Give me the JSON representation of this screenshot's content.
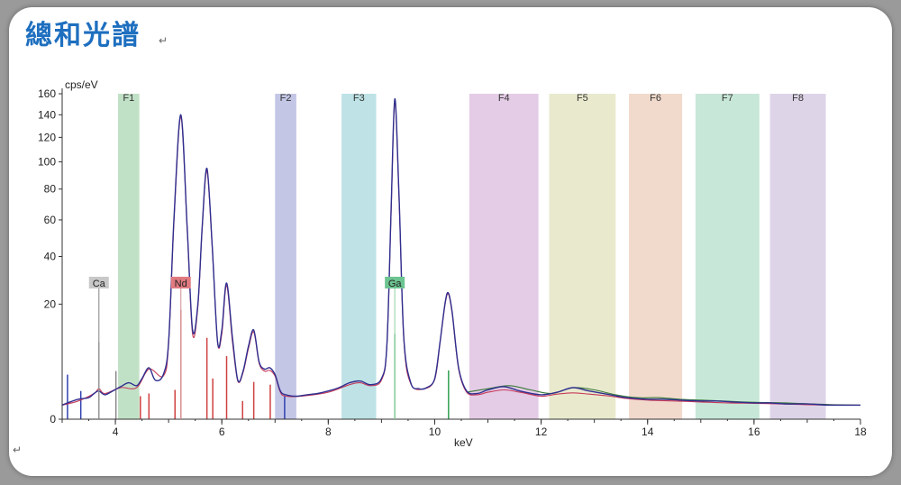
{
  "page": {
    "title": "總和光譜",
    "para_mark": "↵"
  },
  "chart_data": {
    "type": "line",
    "ylabel": "cps/eV",
    "xlabel": "keV",
    "xlim": [
      3.0,
      18.0
    ],
    "ylim": [
      0,
      160
    ],
    "y_scale": "sqrt",
    "x_ticks": [
      4,
      6,
      8,
      10,
      12,
      14,
      16,
      18
    ],
    "y_ticks": [
      0,
      20,
      40,
      60,
      80,
      100,
      120,
      140,
      160
    ],
    "grid": false,
    "bands": [
      {
        "name": "F1",
        "x0": 4.05,
        "x1": 4.45,
        "color": "#b6dcbc"
      },
      {
        "name": "F2",
        "x0": 7.0,
        "x1": 7.4,
        "color": "#b9bce0"
      },
      {
        "name": "F3",
        "x0": 8.25,
        "x1": 8.9,
        "color": "#b3dde0"
      },
      {
        "name": "F4",
        "x0": 10.65,
        "x1": 11.95,
        "color": "#dfc3e2"
      },
      {
        "name": "F5",
        "x0": 12.15,
        "x1": 13.4,
        "color": "#e5e6c4"
      },
      {
        "name": "F6",
        "x0": 13.65,
        "x1": 14.65,
        "color": "#efd3c3"
      },
      {
        "name": "F7",
        "x0": 14.9,
        "x1": 16.1,
        "color": "#bde3d1"
      },
      {
        "name": "F8",
        "x0": 16.3,
        "x1": 17.35,
        "color": "#d8cce4"
      }
    ],
    "elements": [
      {
        "symbol": "Ca",
        "x": 3.69,
        "label_y": 28,
        "box": "#c8c8c8",
        "line": "#999999"
      },
      {
        "symbol": "Nd",
        "x": 5.23,
        "label_y": 28,
        "box": "#e07a80",
        "line": "#d9a0a4"
      },
      {
        "symbol": "Ga",
        "x": 9.25,
        "label_y": 28,
        "box": "#6cc490",
        "line": "#9fd8b0"
      }
    ],
    "markers": [
      {
        "x": 3.1,
        "h": 3.0,
        "color": "#3040b0"
      },
      {
        "x": 3.35,
        "h": 1.2,
        "color": "#3040b0"
      },
      {
        "x": 3.69,
        "h": 9.0,
        "color": "#888888"
      },
      {
        "x": 4.01,
        "h": 3.5,
        "color": "#888888"
      },
      {
        "x": 4.63,
        "h": 1.0,
        "color": "#d04040"
      },
      {
        "x": 4.47,
        "h": 0.8,
        "color": "#d04040"
      },
      {
        "x": 5.12,
        "h": 1.3,
        "color": "#d04040"
      },
      {
        "x": 5.23,
        "h": 18.0,
        "color": "#d04040"
      },
      {
        "x": 5.72,
        "h": 10.0,
        "color": "#d04040"
      },
      {
        "x": 5.83,
        "h": 2.5,
        "color": "#d04040"
      },
      {
        "x": 6.09,
        "h": 6.0,
        "color": "#d04040"
      },
      {
        "x": 6.39,
        "h": 0.5,
        "color": "#d04040"
      },
      {
        "x": 6.6,
        "h": 2.1,
        "color": "#d04040"
      },
      {
        "x": 6.91,
        "h": 1.8,
        "color": "#d04040"
      },
      {
        "x": 7.18,
        "h": 0.8,
        "color": "#3040b0"
      },
      {
        "x": 9.25,
        "h": 11.0,
        "color": "#30a050"
      },
      {
        "x": 10.26,
        "h": 3.6,
        "color": "#30a050"
      }
    ],
    "series": [
      {
        "color": "#2f2f8f",
        "x": [
          3.0,
          3.1,
          3.3,
          3.5,
          3.6,
          3.69,
          3.8,
          3.95,
          4.1,
          4.25,
          4.4,
          4.5,
          4.63,
          4.75,
          4.9,
          5.0,
          5.1,
          5.23,
          5.35,
          5.45,
          5.55,
          5.63,
          5.72,
          5.82,
          5.92,
          6.0,
          6.09,
          6.2,
          6.3,
          6.4,
          6.5,
          6.6,
          6.7,
          6.8,
          6.9,
          7.0,
          7.1,
          7.2,
          7.4,
          7.6,
          7.8,
          8.0,
          8.2,
          8.4,
          8.6,
          8.8,
          9.0,
          9.1,
          9.18,
          9.25,
          9.33,
          9.42,
          9.55,
          9.7,
          9.85,
          10.0,
          10.1,
          10.2,
          10.26,
          10.33,
          10.45,
          10.6,
          10.8,
          11.0,
          11.3,
          11.6,
          12.0,
          12.3,
          12.6,
          12.9,
          13.3,
          13.6,
          14.0,
          14.3,
          14.6,
          15.0,
          15.3,
          15.6,
          16.0,
          16.3,
          16.6,
          17.0,
          17.4,
          17.8,
          18.0
        ],
        "y": [
          0.3,
          0.4,
          0.6,
          0.7,
          1.0,
          1.2,
          0.9,
          1.2,
          1.6,
          2.0,
          1.7,
          2.5,
          4.0,
          2.3,
          3.0,
          9.0,
          60,
          140,
          55,
          12,
          20,
          55,
          95,
          45,
          9,
          12,
          28,
          10,
          2.3,
          3.5,
          8,
          12,
          5,
          3.8,
          4.0,
          3.0,
          1.2,
          0.9,
          0.8,
          0.9,
          1.0,
          1.2,
          1.5,
          2.0,
          2.2,
          1.8,
          2.5,
          8.0,
          65,
          155,
          75,
          10,
          2.0,
          1.4,
          1.5,
          2.5,
          9.0,
          21,
          24,
          17,
          4.0,
          1.2,
          1.0,
          1.3,
          1.6,
          1.2,
          0.9,
          1.1,
          1.5,
          1.2,
          0.9,
          0.7,
          0.6,
          0.6,
          0.55,
          0.5,
          0.5,
          0.45,
          0.4,
          0.4,
          0.35,
          0.35,
          0.3,
          0.3,
          0.3
        ]
      },
      {
        "color": "#c83a5a",
        "x": [
          3.0,
          3.3,
          3.6,
          3.69,
          3.8,
          4.1,
          4.4,
          4.63,
          4.9,
          5.0,
          5.1,
          5.23,
          5.35,
          5.45,
          5.55,
          5.63,
          5.72,
          5.82,
          5.92,
          6.0,
          6.09,
          6.2,
          6.3,
          6.4,
          6.5,
          6.6,
          6.7,
          6.8,
          6.9,
          7.0,
          7.1,
          7.2,
          7.5,
          8.0,
          8.4,
          8.6,
          8.8,
          9.0,
          9.1,
          9.18,
          9.25,
          9.33,
          9.42,
          9.55,
          9.8,
          10.0,
          10.1,
          10.2,
          10.26,
          10.33,
          10.45,
          10.6,
          10.8,
          11.0,
          11.3,
          11.6,
          12.0,
          12.3,
          12.6,
          12.9,
          13.3,
          13.6,
          14.0,
          14.5,
          15.0,
          15.5,
          16.0,
          16.5,
          17.0,
          17.5,
          18.0
        ],
        "y": [
          0.3,
          0.5,
          1.0,
          1.4,
          1.0,
          1.5,
          1.5,
          3.8,
          2.8,
          8.5,
          58,
          138,
          54,
          11,
          19,
          54,
          93,
          44,
          9,
          11,
          27,
          9,
          2.2,
          3.3,
          7.5,
          11.5,
          4.8,
          3.5,
          3.6,
          2.8,
          1.1,
          0.8,
          0.8,
          1.1,
          1.8,
          2.0,
          1.7,
          2.3,
          7.8,
          63,
          152,
          73,
          9.5,
          1.9,
          1.4,
          2.4,
          8.8,
          20.5,
          23.5,
          16.5,
          3.8,
          1.1,
          0.9,
          1.1,
          1.3,
          1.1,
          0.8,
          0.95,
          1.05,
          0.95,
          0.8,
          0.65,
          0.55,
          0.5,
          0.45,
          0.4,
          0.38,
          0.35,
          0.32,
          0.3,
          0.3
        ]
      },
      {
        "color": "#3a7a3a",
        "x": [
          10.6,
          11.0,
          11.4,
          11.8,
          12.2,
          12.6,
          13.0,
          13.4,
          13.8,
          14.2,
          14.6,
          15.0,
          15.4,
          15.8,
          16.2,
          16.6,
          17.0,
          17.5,
          18.0
        ],
        "y": [
          1.1,
          1.4,
          1.7,
          1.3,
          1.0,
          1.5,
          1.3,
          0.9,
          0.7,
          0.7,
          0.6,
          0.55,
          0.5,
          0.45,
          0.42,
          0.4,
          0.36,
          0.32,
          0.3
        ]
      }
    ]
  }
}
